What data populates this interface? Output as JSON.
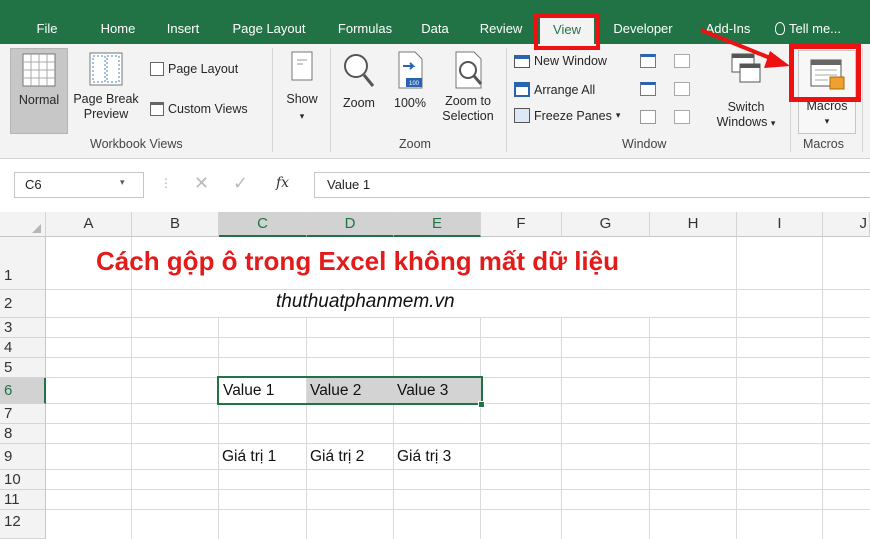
{
  "tabs": [
    {
      "label": "File"
    },
    {
      "label": "Home"
    },
    {
      "label": "Insert"
    },
    {
      "label": "Page Layout"
    },
    {
      "label": "Formulas"
    },
    {
      "label": "Data"
    },
    {
      "label": "Review"
    },
    {
      "label": "View"
    },
    {
      "label": "Developer"
    },
    {
      "label": "Add-Ins"
    }
  ],
  "tell_me": "Tell me...",
  "ribbon": {
    "normal": "Normal",
    "page_break_preview_line1": "Page Break",
    "page_break_preview_line2": "Preview",
    "page_layout": "Page Layout",
    "custom_views": "Custom Views",
    "workbook_views_label": "Workbook Views",
    "show": "Show",
    "zoom": "Zoom",
    "zoom_100": "100%",
    "zoom_to_selection_line1": "Zoom to",
    "zoom_to_selection_line2": "Selection",
    "zoom_group_label": "Zoom",
    "new_window": "New Window",
    "arrange_all": "Arrange All",
    "freeze_panes": "Freeze Panes",
    "window_group_label": "Window",
    "switch_windows_line1": "Switch",
    "switch_windows_line2": "Windows",
    "macros": "Macros",
    "macros_group_label": "Macros",
    "badge_100": "100"
  },
  "formula_bar": {
    "name_box": "C6",
    "fx": "fx",
    "formula_value": "Value 1"
  },
  "columns": [
    "A",
    "B",
    "C",
    "D",
    "E",
    "F",
    "G",
    "H",
    "I",
    "J"
  ],
  "rows": [
    "1",
    "2",
    "3",
    "4",
    "5",
    "6",
    "7",
    "8",
    "9",
    "10",
    "11",
    "12"
  ],
  "cells": {
    "title": "Cách gộp ô trong Excel không mất dữ liệu",
    "subtitle": "thuthuatphanmem.vn",
    "c6": "Value 1",
    "d6": "Value 2",
    "e6": "Value 3",
    "c9": "Giá trị 1",
    "d9": "Giá trị 2",
    "e9": "Giá trị 3"
  },
  "colors": {
    "excel_green": "#217346",
    "highlight_red": "#ee1111",
    "title_red": "#e31b1b"
  }
}
